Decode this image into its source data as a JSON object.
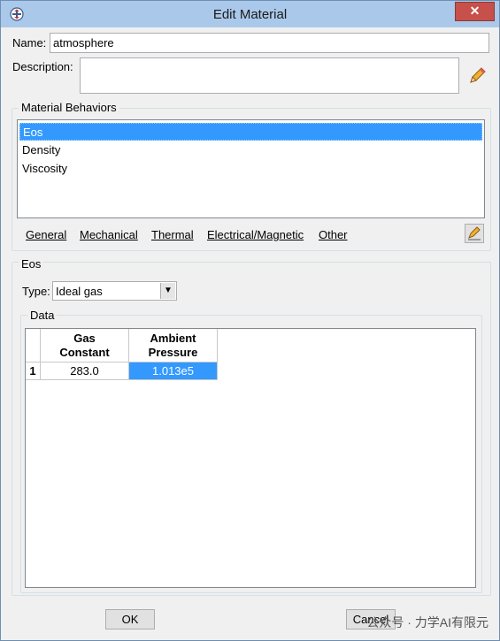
{
  "window": {
    "title": "Edit Material"
  },
  "name": {
    "label": "Name:",
    "value": "atmosphere"
  },
  "description": {
    "label": "Description:",
    "value": ""
  },
  "behaviors": {
    "group_label": "Material Behaviors",
    "items": [
      "Eos",
      "Density",
      "Viscosity"
    ],
    "selected": "Eos"
  },
  "menu": {
    "general": "General",
    "mechanical": "Mechanical",
    "thermal": "Thermal",
    "electrical": "Electrical/Magnetic",
    "other": "Other"
  },
  "eos": {
    "group_label": "Eos",
    "type_label": "Type:",
    "type_value": "Ideal gas"
  },
  "data": {
    "group_label": "Data",
    "columns": [
      {
        "line1": "Gas",
        "line2": "Constant"
      },
      {
        "line1": "Ambient",
        "line2": "Pressure"
      }
    ],
    "rows": [
      {
        "index": "1",
        "cells": [
          "283.0",
          "1.013e5"
        ]
      }
    ]
  },
  "buttons": {
    "ok": "OK",
    "cancel": "Cancel"
  },
  "watermark": "公众号 · 力学AI有限元"
}
